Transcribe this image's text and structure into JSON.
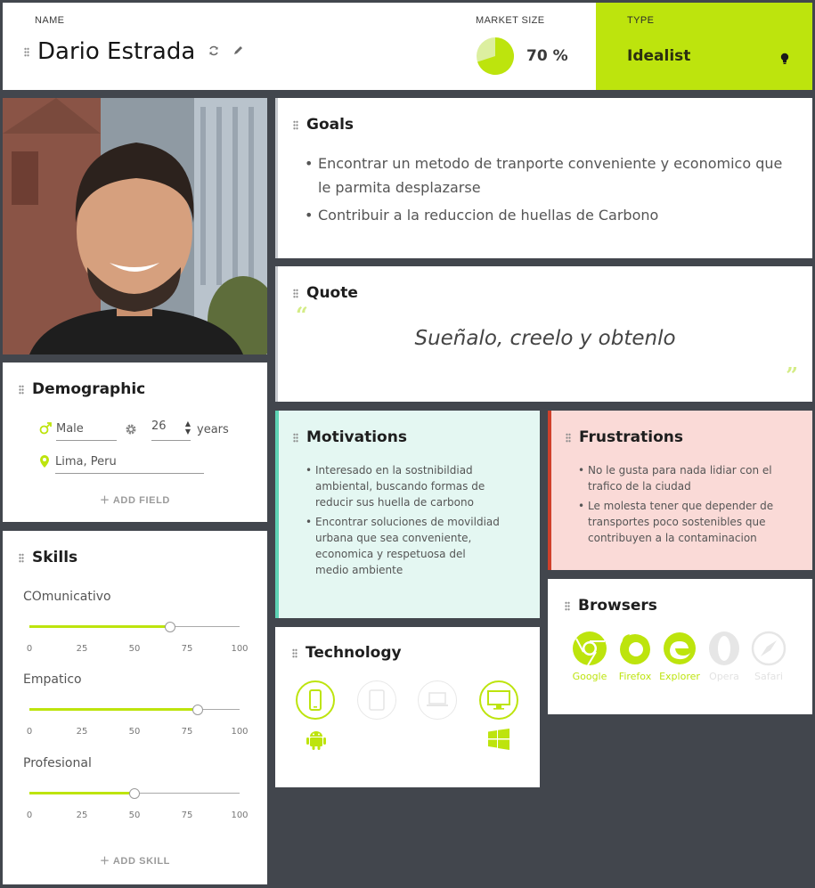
{
  "header": {
    "name_label": "NAME",
    "name": "Dario Estrada",
    "market_label": "MARKET SIZE",
    "market_percent": 70,
    "market_value": "70 %",
    "type_label": "TYPE",
    "type_value": "Idealist"
  },
  "demographic": {
    "title": "Demographic",
    "gender": "Male",
    "age": "26",
    "age_unit": "years",
    "location": "Lima, Peru",
    "add_field": "ADD FIELD"
  },
  "skills": {
    "title": "Skills",
    "ticks": [
      "0",
      "25",
      "50",
      "75",
      "100"
    ],
    "items": [
      {
        "name": "COmunicativo",
        "value": 67
      },
      {
        "name": "Empatico",
        "value": 80
      },
      {
        "name": "Profesional",
        "value": 50
      }
    ],
    "add_skill": "ADD SKILL"
  },
  "goals": {
    "title": "Goals",
    "items": [
      "Encontrar un metodo de tranporte conveniente y economico que le parmita desplazarse",
      "Contribuir a la reduccion de huellas de Carbono"
    ]
  },
  "quote": {
    "title": "Quote",
    "text": "Sueñalo, creelo y obtenlo"
  },
  "motivations": {
    "title": "Motivations",
    "items": [
      "Interesado en la sostnibildiad ambiental, buscando formas de reducir sus huella de carbono",
      "Encontrar soluciones de movildiad urbana que sea conveniente, economica y respetuosa del medio ambiente"
    ]
  },
  "frustrations": {
    "title": "Frustrations",
    "items": [
      "No le gusta para nada lidiar con el trafico de la ciudad",
      "Le molesta tener que depender de transportes poco sostenibles que contribuyen a la contaminacion"
    ]
  },
  "technology": {
    "title": "Technology",
    "devices": [
      {
        "icon": "smartphone-icon",
        "active": true
      },
      {
        "icon": "tablet-icon",
        "active": false
      },
      {
        "icon": "laptop-icon",
        "active": false
      },
      {
        "icon": "desktop-icon",
        "active": true
      }
    ],
    "os": [
      "android-icon",
      "windows-icon"
    ]
  },
  "browsers": {
    "title": "Browsers",
    "items": [
      {
        "name": "Google",
        "active": true
      },
      {
        "name": "Firefox",
        "active": true
      },
      {
        "name": "Explorer",
        "active": true
      },
      {
        "name": "Opera",
        "active": false
      },
      {
        "name": "Safari",
        "active": false
      }
    ]
  },
  "colors": {
    "accent": "#bde40d",
    "background": "#42464d",
    "motivations_bg": "#e4f7f2",
    "motivations_border": "#5ed3b4",
    "frustrations_bg": "#fadad7",
    "frustrations_border": "#d0402b"
  }
}
